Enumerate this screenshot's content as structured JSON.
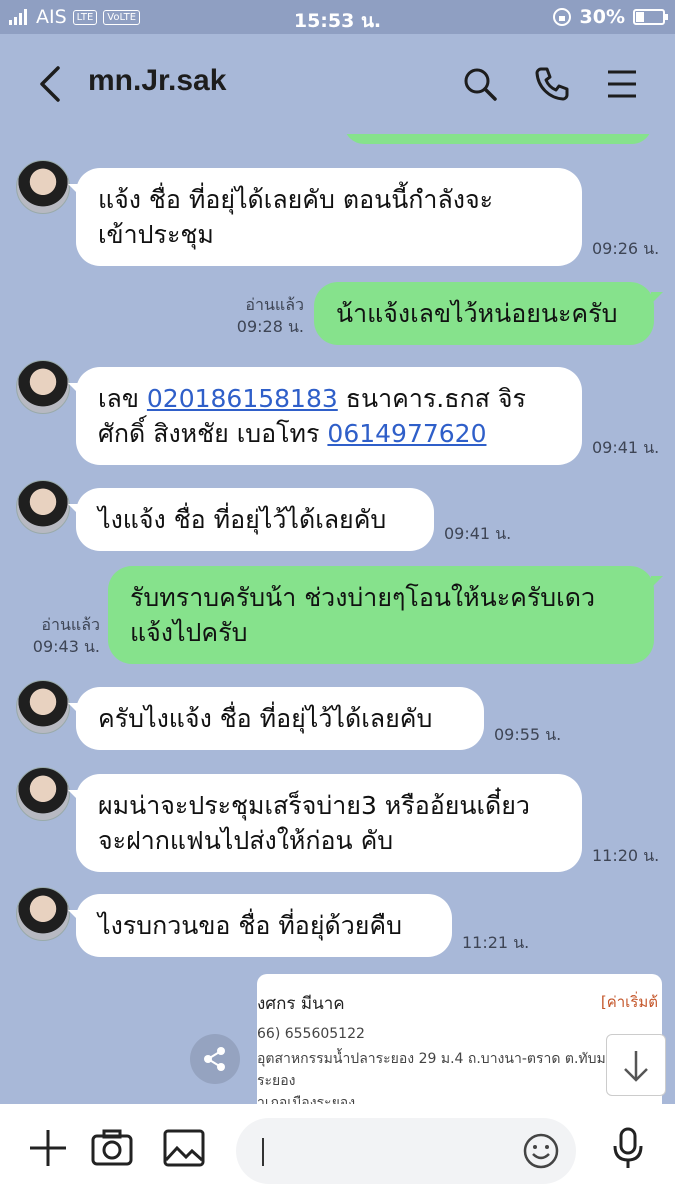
{
  "status": {
    "carrier": "AIS",
    "net_badge": "LTE",
    "time": "15:53 น.",
    "battery": "30%",
    "battery_level": 0.3
  },
  "header": {
    "title": "mn.Jr.sak"
  },
  "messages": [
    {
      "side": "in",
      "text": "แจ้ง ชื่อ ที่อยุ่ได้เลยคับ ตอนนี้กำลังจะ\nเข้าประชุม",
      "time": "09:26 น."
    },
    {
      "side": "out",
      "text": "น้าแจ้งเลขไว้หน่อยนะครับ",
      "read": "อ่านแล้ว",
      "time": "09:28 น."
    },
    {
      "side": "in",
      "text_pre": "เลข ",
      "link1": "020186158183",
      "text_mid": " ธนาคาร.ธกส จิร\nศักดิ์ สิงหชัย เบอโทร ",
      "link2": "0614977620",
      "time": "09:41 น."
    },
    {
      "side": "in",
      "text": "ไงแจ้ง ชื่อ ที่อยุ่ไว้ได้เลยคับ",
      "time": "09:41 น."
    },
    {
      "side": "out",
      "text": "รับทราบครับน้า ช่วงบ่ายๆโอนให้นะครับเดว\nแจ้งไปครับ",
      "read": "อ่านแล้ว",
      "time": "09:43 น."
    },
    {
      "side": "in",
      "text": "ครับไงแจ้ง ชื่อ ที่อยุ่ไว้ได้เลยคับ",
      "time": "09:55 น."
    },
    {
      "side": "in",
      "text": "ผมน่าจะประชุมเสร็จบ่าย3 หรืออ้ยนเดี๋ยว\nจะฝากแฟนไปส่งให้ก่อน คับ",
      "time": "11:20 น."
    },
    {
      "side": "in",
      "text": "ไงรบกวนขอ ชื่อ ที่อยุ่ด้วยคืบ",
      "time": "11:21 น."
    }
  ],
  "card": {
    "name": "งศกร มีนาค",
    "tag": "[ค่าเริ่มต้",
    "phone": "66) 655605122",
    "address1": "อุตสาหกรรมน้ำปลาระยอง 29 ม.4 ถ.บางนา-ตราด ต.ทับมา อ.เมือ",
    "address2": "ระยอง",
    "address3": "าเภอเมืองระยอง"
  }
}
